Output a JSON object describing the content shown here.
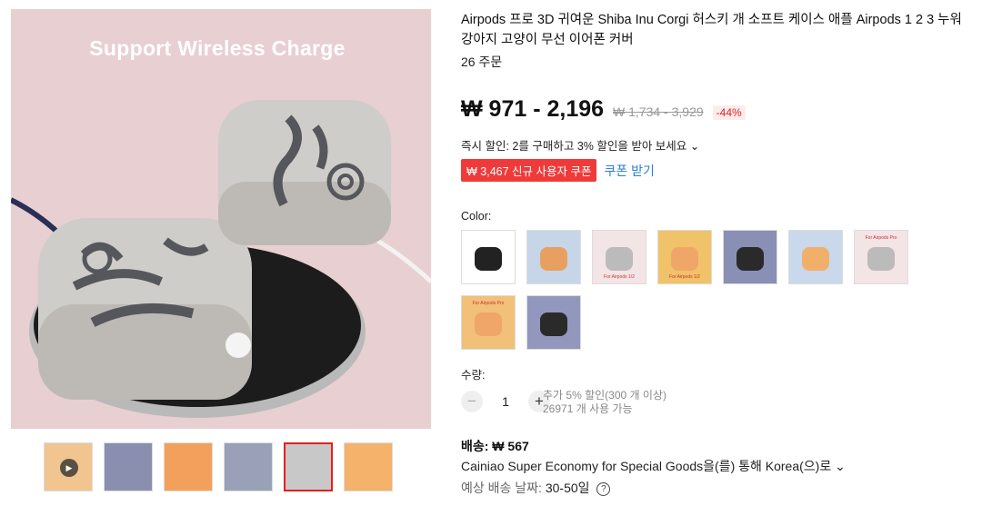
{
  "product": {
    "title": "Airpods 프로 3D 귀여운 Shiba Inu Corgi 허스키 개 소프트 케이스 애플 Airpods 1 2 3 누워 강아지 고양이 무선 이어폰 커버",
    "orders": "26 주문",
    "price": "₩ 971 - 2,196",
    "original_price": "₩ 1,734 - 3,929",
    "discount": "-44%",
    "instant_discount": "즉시 할인: 2를 구매하고 3% 할인을 받아 보세요",
    "coupon_tag": "₩ 3,467 신규 사용자 쿠폰",
    "coupon_link": "쿠폰 받기"
  },
  "main_image": {
    "banner": "Support Wireless Charge"
  },
  "thumbnails": [
    {
      "color": "#f0c590",
      "video": true
    },
    {
      "color": "#8a8fb0"
    },
    {
      "color": "#f2a05c"
    },
    {
      "color": "#9aa0b8"
    },
    {
      "color": "#c8c8c8",
      "active": true
    },
    {
      "color": "#f4b26a"
    }
  ],
  "color_section": {
    "label": "Color:",
    "options": [
      {
        "bg": "#ffffff",
        "obj": "#222222"
      },
      {
        "bg": "#c7d5e8",
        "obj": "#e8a060"
      },
      {
        "bg": "#f3e4e6",
        "obj": "#bbbbbb",
        "caption": "For Airpods 1/2"
      },
      {
        "bg": "#f0c26a",
        "obj": "#f0a668",
        "caption": "For Airpods 1/2"
      },
      {
        "bg": "#8a8fb5",
        "obj": "#2a2a2a"
      },
      {
        "bg": "#c9d8ea",
        "obj": "#f0b06a"
      },
      {
        "bg": "#f3e4e6",
        "obj": "#bbbbbb",
        "caption": "For Airpods Pro"
      },
      {
        "bg": "#f2c078",
        "obj": "#f0a668",
        "caption": "For Airpods Pro"
      },
      {
        "bg": "#9297bd",
        "obj": "#2a2a2a"
      }
    ]
  },
  "quantity": {
    "label": "수량:",
    "value": "1",
    "minus": "−",
    "plus": "+",
    "note_line1": "추가 5% 할인(300 개 이상)",
    "note_line2": "26971 개 사용 가능"
  },
  "shipping": {
    "title": "배송: ₩ 567",
    "desc": "Cainiao Super Economy for Special Goods을(를) 통해 Korea(으)로",
    "delivery_label": "예상 배송 날짜: ",
    "delivery_value": "30-50일",
    "help_icon": "?"
  },
  "colors": {
    "accent_red": "#e02020",
    "coupon_bg": "#f03a3a",
    "link_blue": "#2a7fd4",
    "image_bg": "#e8cfd1"
  }
}
